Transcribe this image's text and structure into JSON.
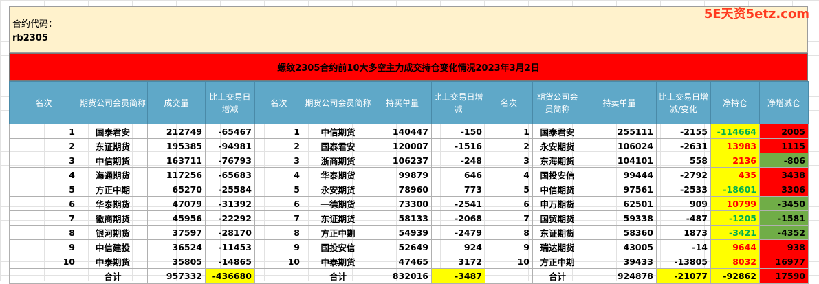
{
  "watermark": "5E天资5etz.com",
  "contract": {
    "label": "合约代码：",
    "code": "rb2305"
  },
  "title": "螺纹2305合约前10大多空主力成交持仓变化情况2023年3月2日",
  "headers": [
    "名次",
    "期货公司会员简称",
    "成交量",
    "比上交易日增减",
    "名次",
    "期货公司会员简称",
    "持买单量",
    "比上交易日增减",
    "名次",
    "期货公司会员简称",
    "持卖单量",
    "比上交易日增减/变化",
    "净持仓",
    "净增减仓"
  ],
  "rows": [
    [
      "1",
      "国泰君安",
      "212749",
      "-65467",
      "1",
      "中信期货",
      "140447",
      "-150",
      "1",
      "国泰君安",
      "255111",
      "-2155",
      "-114664",
      "2005"
    ],
    [
      "2",
      "东证期货",
      "195385",
      "-94981",
      "2",
      "国泰君安",
      "120007",
      "-1516",
      "2",
      "永安期货",
      "106024",
      "-2631",
      "13983",
      "1115"
    ],
    [
      "3",
      "中信期货",
      "163711",
      "-76793",
      "3",
      "浙商期货",
      "106237",
      "-248",
      "3",
      "东海期货",
      "104101",
      "558",
      "2136",
      "-806"
    ],
    [
      "4",
      "海通期货",
      "117256",
      "-65683",
      "4",
      "华泰期货",
      "99879",
      "646",
      "4",
      "国投安信",
      "99444",
      "-2792",
      "435",
      "3438"
    ],
    [
      "5",
      "方正中期",
      "65270",
      "-25584",
      "5",
      "永安期货",
      "78960",
      "773",
      "5",
      "中信期货",
      "97561",
      "-2533",
      "-18601",
      "3306"
    ],
    [
      "6",
      "华泰期货",
      "47079",
      "-31392",
      "6",
      "一德期货",
      "73300",
      "-2541",
      "6",
      "申万期货",
      "62501",
      "909",
      "10799",
      "-3450"
    ],
    [
      "7",
      "徽商期货",
      "45956",
      "-22292",
      "7",
      "东证期货",
      "58133",
      "-2068",
      "7",
      "国贸期货",
      "59338",
      "-487",
      "-1205",
      "-1581"
    ],
    [
      "8",
      "银河期货",
      "37597",
      "-28170",
      "8",
      "方正中期",
      "54939",
      "-2479",
      "8",
      "东证期货",
      "58360",
      "1873",
      "-3421",
      "-4352"
    ],
    [
      "9",
      "中信建投",
      "36524",
      "-11453",
      "9",
      "国投安信",
      "52649",
      "924",
      "9",
      "瑞达期货",
      "43005",
      "-14",
      "9644",
      "938"
    ],
    [
      "10",
      "中泰期货",
      "35805",
      "-14865",
      "10",
      "中泰期货",
      "47465",
      "3172",
      "10",
      "方正中期",
      "39433",
      "-13805",
      "8032",
      "16977"
    ]
  ],
  "total": {
    "label1": "合计",
    "vol": "957332",
    "vol_chg": "-436680",
    "label2": "合计",
    "buy": "832016",
    "buy_chg": "-3487",
    "label3": "合计",
    "sell": "924878",
    "sell_chg": "-21077",
    "net": "-92862",
    "net_chg": "17590"
  },
  "colors": {
    "header": "#5fa8c8",
    "title_bar": "#ff0000",
    "info_bg": "#fff2cc",
    "highlight_yellow": "#ffff00",
    "highlight_red": "#ff0000",
    "highlight_green": "#70ad47"
  }
}
